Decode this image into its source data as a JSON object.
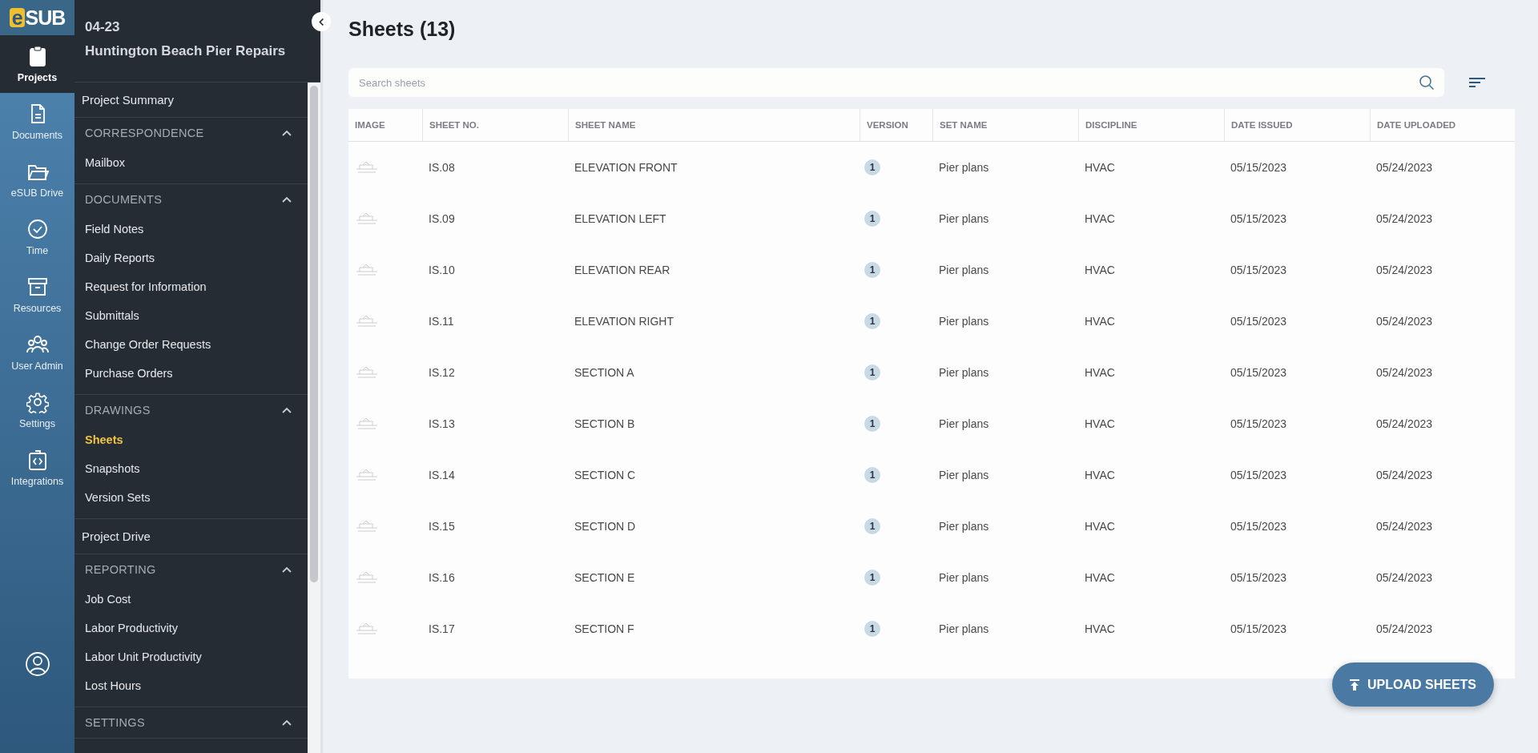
{
  "rail": {
    "logo": {
      "mark": "e",
      "text": "SUB"
    },
    "items": [
      {
        "label": "Projects",
        "selected": true
      },
      {
        "label": "Documents",
        "selected": false
      },
      {
        "label": "eSUB Drive",
        "selected": false
      },
      {
        "label": "Time",
        "selected": false
      },
      {
        "label": "Resources",
        "selected": false
      },
      {
        "label": "User Admin",
        "selected": false
      },
      {
        "label": "Settings",
        "selected": false
      },
      {
        "label": "Integrations",
        "selected": false
      }
    ]
  },
  "sidebar": {
    "project_number": "04-23",
    "project_name": "Huntington Beach Pier Repairs",
    "nav": [
      {
        "kind": "link",
        "label": "Project Summary"
      },
      {
        "kind": "section",
        "title": "CORRESPONDENCE",
        "expanded": true,
        "items": [
          {
            "label": "Mailbox",
            "selected": false
          }
        ]
      },
      {
        "kind": "section",
        "title": "DOCUMENTS",
        "expanded": true,
        "items": [
          {
            "label": "Field Notes",
            "selected": false
          },
          {
            "label": "Daily Reports",
            "selected": false
          },
          {
            "label": "Request for Information",
            "selected": false
          },
          {
            "label": "Submittals",
            "selected": false
          },
          {
            "label": "Change Order Requests",
            "selected": false
          },
          {
            "label": "Purchase Orders",
            "selected": false
          }
        ]
      },
      {
        "kind": "section",
        "title": "DRAWINGS",
        "expanded": true,
        "items": [
          {
            "label": "Sheets",
            "selected": true
          },
          {
            "label": "Snapshots",
            "selected": false
          },
          {
            "label": "Version Sets",
            "selected": false
          }
        ]
      },
      {
        "kind": "link",
        "label": "Project Drive"
      },
      {
        "kind": "section",
        "title": "REPORTING",
        "expanded": true,
        "items": [
          {
            "label": "Job Cost",
            "selected": false
          },
          {
            "label": "Labor Productivity",
            "selected": false
          },
          {
            "label": "Labor Unit Productivity",
            "selected": false
          },
          {
            "label": "Lost Hours",
            "selected": false
          }
        ]
      },
      {
        "kind": "section",
        "title": "SETTINGS",
        "expanded": true
      }
    ]
  },
  "main": {
    "title": "Sheets (13)",
    "search": {
      "placeholder": "Search sheets"
    },
    "table": {
      "columns": [
        "IMAGE",
        "SHEET NO.",
        "SHEET NAME",
        "VERSION",
        "SET NAME",
        "DISCIPLINE",
        "DATE ISSUED",
        "DATE UPLOADED"
      ],
      "rows": [
        {
          "sheet_no": "IS.08",
          "sheet_name": "ELEVATION FRONT",
          "version": "1",
          "set_name": "Pier plans",
          "discipline": "HVAC",
          "date_issued": "05/15/2023",
          "date_uploaded": "05/24/2023"
        },
        {
          "sheet_no": "IS.09",
          "sheet_name": "ELEVATION LEFT",
          "version": "1",
          "set_name": "Pier plans",
          "discipline": "HVAC",
          "date_issued": "05/15/2023",
          "date_uploaded": "05/24/2023"
        },
        {
          "sheet_no": "IS.10",
          "sheet_name": "ELEVATION REAR",
          "version": "1",
          "set_name": "Pier plans",
          "discipline": "HVAC",
          "date_issued": "05/15/2023",
          "date_uploaded": "05/24/2023"
        },
        {
          "sheet_no": "IS.11",
          "sheet_name": "ELEVATION RIGHT",
          "version": "1",
          "set_name": "Pier plans",
          "discipline": "HVAC",
          "date_issued": "05/15/2023",
          "date_uploaded": "05/24/2023"
        },
        {
          "sheet_no": "IS.12",
          "sheet_name": "SECTION A",
          "version": "1",
          "set_name": "Pier plans",
          "discipline": "HVAC",
          "date_issued": "05/15/2023",
          "date_uploaded": "05/24/2023"
        },
        {
          "sheet_no": "IS.13",
          "sheet_name": "SECTION B",
          "version": "1",
          "set_name": "Pier plans",
          "discipline": "HVAC",
          "date_issued": "05/15/2023",
          "date_uploaded": "05/24/2023"
        },
        {
          "sheet_no": "IS.14",
          "sheet_name": "SECTION C",
          "version": "1",
          "set_name": "Pier plans",
          "discipline": "HVAC",
          "date_issued": "05/15/2023",
          "date_uploaded": "05/24/2023"
        },
        {
          "sheet_no": "IS.15",
          "sheet_name": "SECTION D",
          "version": "1",
          "set_name": "Pier plans",
          "discipline": "HVAC",
          "date_issued": "05/15/2023",
          "date_uploaded": "05/24/2023"
        },
        {
          "sheet_no": "IS.16",
          "sheet_name": "SECTION E",
          "version": "1",
          "set_name": "Pier plans",
          "discipline": "HVAC",
          "date_issued": "05/15/2023",
          "date_uploaded": "05/24/2023"
        },
        {
          "sheet_no": "IS.17",
          "sheet_name": "SECTION F",
          "version": "1",
          "set_name": "Pier plans",
          "discipline": "HVAC",
          "date_issued": "05/15/2023",
          "date_uploaded": "05/24/2023"
        }
      ]
    },
    "upload_button": {
      "label": "UPLOAD SHEETS"
    }
  }
}
